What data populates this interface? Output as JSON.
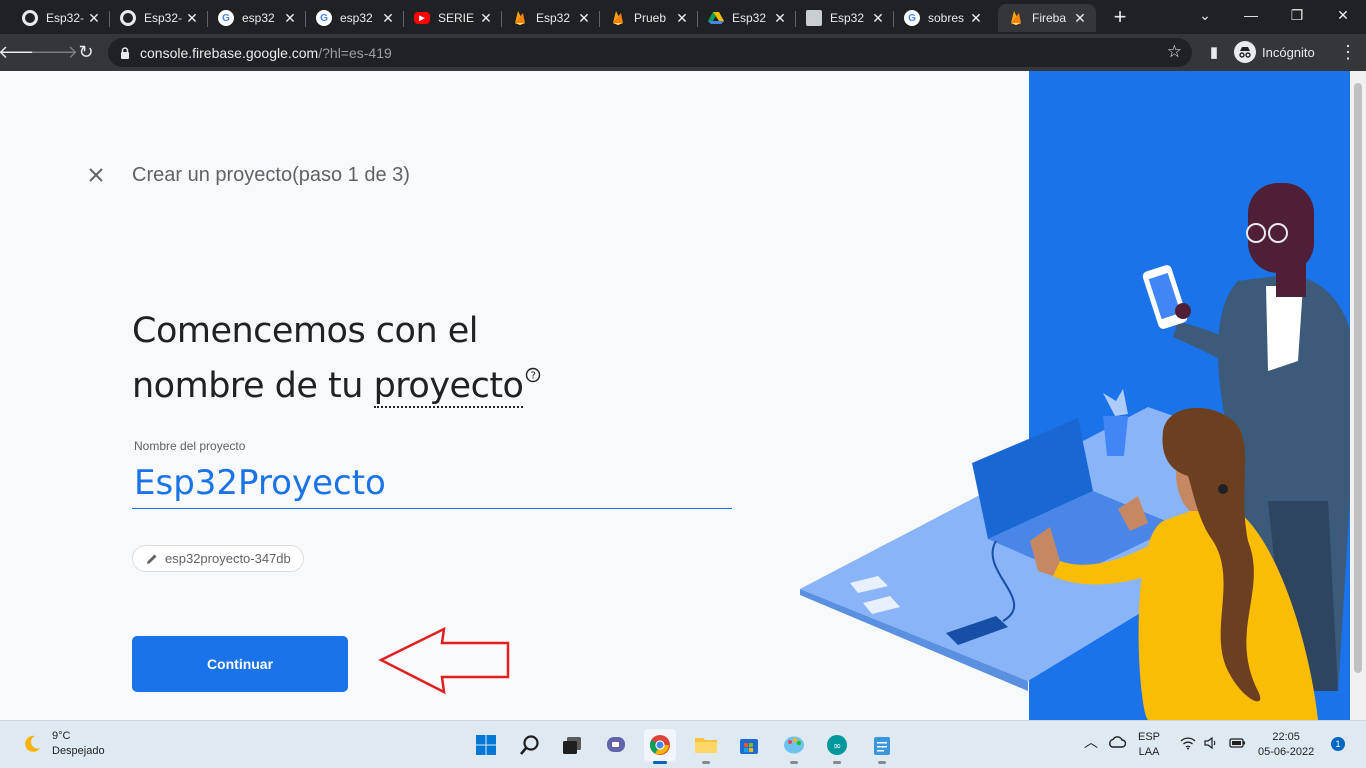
{
  "browser": {
    "tabs": [
      {
        "title": "Esp32-",
        "favicon": "github-icon"
      },
      {
        "title": "Esp32-",
        "favicon": "github-icon"
      },
      {
        "title": "esp32",
        "favicon": "google-icon"
      },
      {
        "title": "esp32",
        "favicon": "google-icon"
      },
      {
        "title": "SERIE",
        "favicon": "youtube-icon"
      },
      {
        "title": "Esp32",
        "favicon": "firebase-icon"
      },
      {
        "title": "Prueb",
        "favicon": "firebase-icon"
      },
      {
        "title": "Esp32",
        "favicon": "drive-icon"
      },
      {
        "title": "Esp32",
        "favicon": "doc-icon"
      },
      {
        "title": "sobres",
        "favicon": "google-icon"
      },
      {
        "title": "Fireba",
        "favicon": "firebase-icon",
        "active": true
      }
    ],
    "url_main": "console.firebase.google.com",
    "url_rest": "/?hl=es-419",
    "profile_label": "Incógnito"
  },
  "page": {
    "step_title": "Crear un proyecto(paso 1 de 3)",
    "heading_line1": "Comencemos con el",
    "heading_line2_prefix": "nombre de tu ",
    "heading_line2_underlined": "proyecto",
    "field_label": "Nombre del proyecto",
    "field_value": "Esp32Proyecto",
    "project_id": "esp32proyecto-347db",
    "continue_label": "Continuar"
  },
  "taskbar": {
    "temperature": "9°C",
    "weather": "Despejado",
    "lang_top": "ESP",
    "lang_bottom": "LAA",
    "time": "22:05",
    "date": "05-06-2022",
    "notifications": "1",
    "pinned_apps": [
      "start-icon",
      "search-icon",
      "task-view-icon",
      "teams-chat-icon",
      "chrome-icon",
      "file-explorer-icon",
      "store-icon",
      "paint-icon",
      "arduino-icon",
      "notepad-icon"
    ]
  },
  "colors": {
    "accent": "#1a73e8",
    "illustration_bg": "#1a73e8",
    "annotation_arrow": "#e02020"
  }
}
